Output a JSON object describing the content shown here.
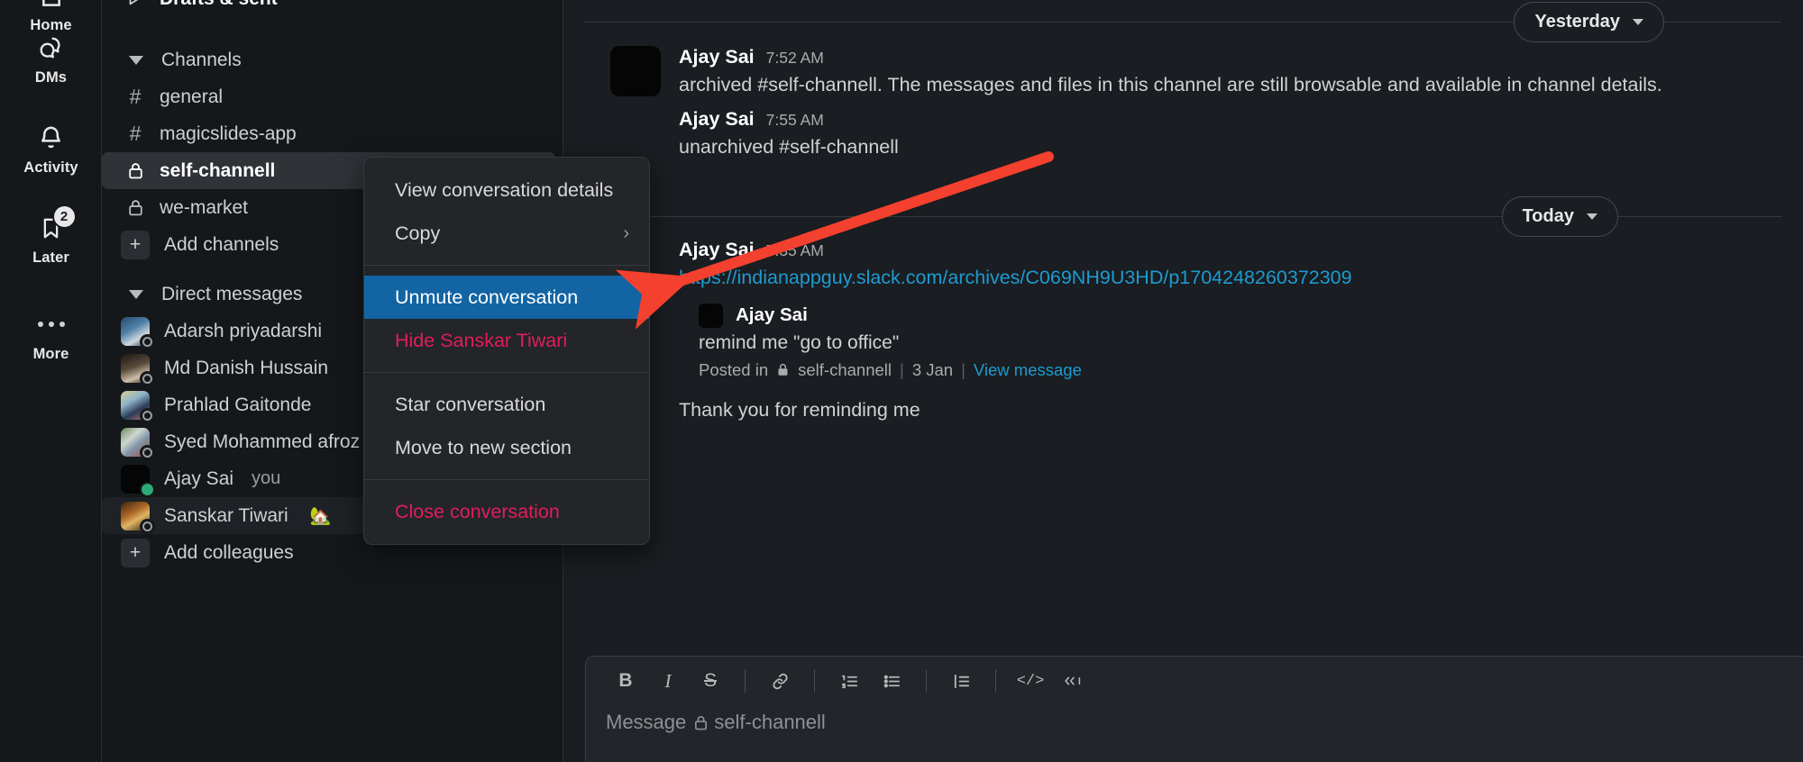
{
  "rail": {
    "items": [
      {
        "label": "Home",
        "icon": "home-icon",
        "badge": null
      },
      {
        "label": "DMs",
        "icon": "dms-icon",
        "badge": null
      },
      {
        "label": "Activity",
        "icon": "bell-icon",
        "badge": null
      },
      {
        "label": "Later",
        "icon": "bookmark-icon",
        "badge": "2"
      },
      {
        "label": "More",
        "icon": "more-icon",
        "badge": null
      }
    ]
  },
  "sidebar": {
    "drafts_label": "Drafts & sent",
    "channels_section": "Channels",
    "channels": [
      {
        "name": "general",
        "icon": "hash-icon",
        "private": false,
        "active": false
      },
      {
        "name": "magicslides-app",
        "icon": "hash-icon",
        "private": false,
        "active": false
      },
      {
        "name": "self-channell",
        "icon": "lock-icon",
        "private": true,
        "active": true
      },
      {
        "name": "we-market",
        "icon": "lock-icon",
        "private": true,
        "active": false
      }
    ],
    "add_channels_label": "Add channels",
    "dm_section": "Direct messages",
    "dms": [
      {
        "name": "Adarsh priyadarshi",
        "presence": "away",
        "tag": "",
        "emoji": ""
      },
      {
        "name": "Md Danish Hussain",
        "presence": "away",
        "tag": "",
        "emoji": ""
      },
      {
        "name": "Prahlad Gaitonde",
        "presence": "away",
        "tag": "",
        "emoji": ""
      },
      {
        "name": "Syed Mohammed afroz",
        "presence": "away",
        "tag": "",
        "emoji": ""
      },
      {
        "name": "Ajay Sai",
        "presence": "dnd",
        "tag": "you",
        "emoji": ""
      },
      {
        "name": "Sanskar Tiwari",
        "presence": "away",
        "tag": "",
        "emoji": "🏡"
      }
    ],
    "add_colleagues_label": "Add colleagues"
  },
  "context_menu": {
    "groups": [
      {
        "items": [
          {
            "label": "View conversation details",
            "style": "normal",
            "submenu": false
          },
          {
            "label": "Copy",
            "style": "normal",
            "submenu": true,
            "chevron": "›"
          }
        ]
      },
      {
        "items": [
          {
            "label": "Unmute conversation",
            "style": "selected",
            "submenu": false
          },
          {
            "label": "Hide Sanskar Tiwari",
            "style": "danger",
            "submenu": false
          }
        ]
      },
      {
        "items": [
          {
            "label": "Star conversation",
            "style": "normal",
            "submenu": false
          },
          {
            "label": "Move to new section",
            "style": "normal",
            "submenu": false
          }
        ]
      },
      {
        "items": [
          {
            "label": "Close conversation",
            "style": "danger",
            "submenu": false
          }
        ]
      }
    ],
    "selected_accent": "#1264a3",
    "danger_color": "#e01e5a"
  },
  "chat": {
    "dividers": {
      "yesterday": "Yesterday",
      "today": "Today"
    },
    "messages": [
      {
        "author": "Ajay Sai",
        "time": "7:52 AM",
        "text": "archived #self-channell. The messages and files in this channel are still browsable and available in channel details."
      },
      {
        "author": "Ajay Sai",
        "time": "7:55 AM",
        "text": "unarchived #self-channell"
      },
      {
        "author": "Ajay Sai",
        "time": "7:35 AM",
        "link": "https://indianappguy.slack.com/archives/C069NH9U3HD/p1704248260372309",
        "quote": {
          "author": "Ajay Sai",
          "text": "remind me \"go to office\"",
          "posted_in_label": "Posted in",
          "channel": "self-channell",
          "date": "3 Jan",
          "view_message": "View message"
        }
      },
      {
        "author": "",
        "time": "",
        "text": "Thank you for reminding me"
      }
    ]
  },
  "composer": {
    "toolbar": [
      {
        "name": "bold-icon",
        "glyph": "B"
      },
      {
        "name": "italic-icon",
        "glyph": "I"
      },
      {
        "name": "strikethrough-icon",
        "glyph": "S"
      },
      {
        "name": "link-icon",
        "glyph": "🔗"
      },
      {
        "name": "ordered-list-icon",
        "glyph": "1."
      },
      {
        "name": "bulleted-list-icon",
        "glyph": "•"
      },
      {
        "name": "blockquote-icon",
        "glyph": "”"
      },
      {
        "name": "code-icon",
        "glyph": "</>"
      },
      {
        "name": "code-block-icon",
        "glyph": "⎇"
      }
    ],
    "placeholder_prefix": "Message",
    "placeholder_channel": "self-channell"
  },
  "annotation": {
    "arrow_color": "#f4402e"
  }
}
